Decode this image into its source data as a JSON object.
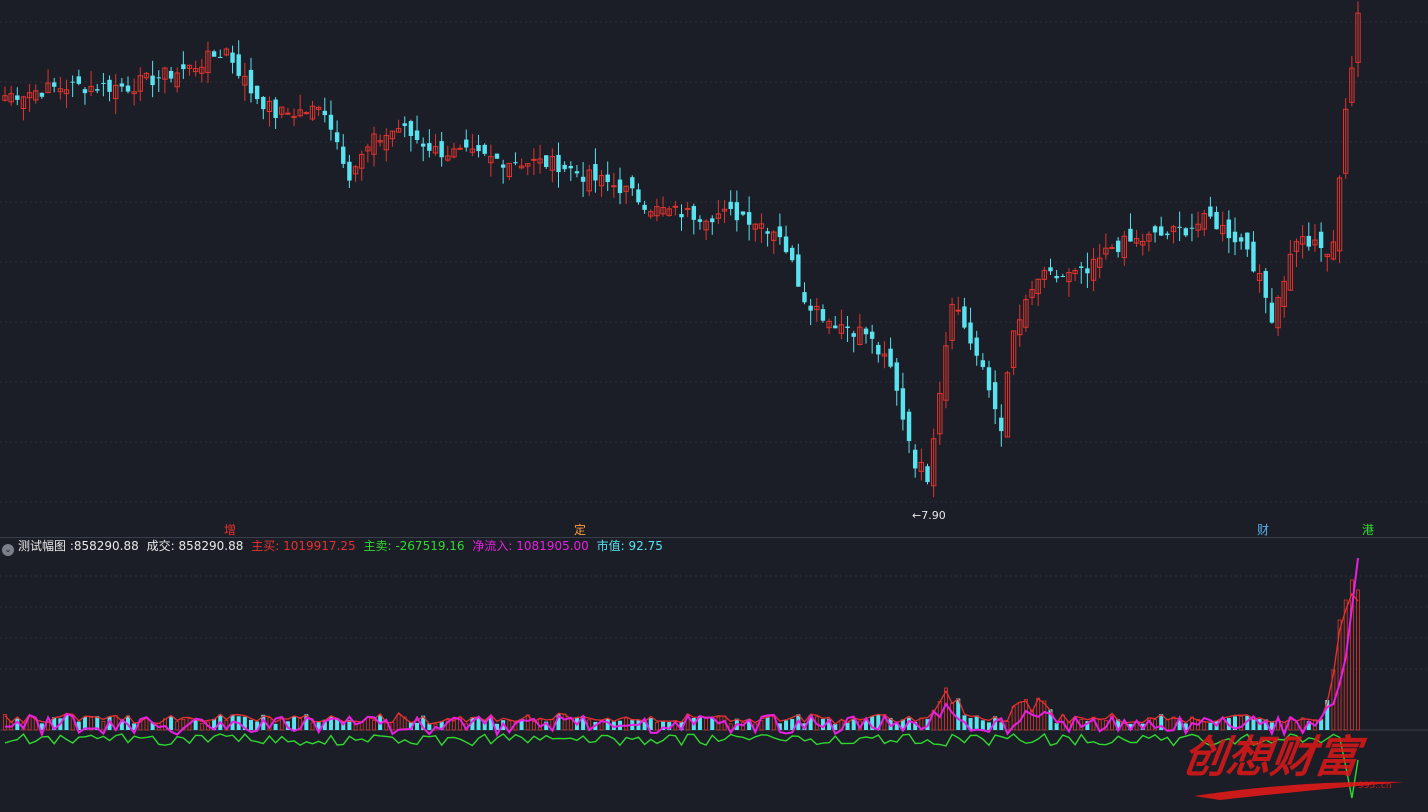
{
  "colors": {
    "background": "#1b1e26",
    "up": "#e0342e",
    "down": "#59e3f0",
    "grid": "#2c303a",
    "main_buy": "#e83030",
    "main_sell": "#30d830",
    "net_inflow": "#e820e0",
    "market_value": "#59e3f0",
    "watermark": "#e01818"
  },
  "chart_data": [
    {
      "type": "candlestick",
      "title": "",
      "price_low_label": "←7.90",
      "event_markers": [
        {
          "label": "增",
          "bar": 36,
          "color": "#e83030"
        },
        {
          "label": "定",
          "bar": 91,
          "color": "#ff9e3d"
        },
        {
          "label": "财",
          "bar": 197,
          "color": "#59aff0"
        },
        {
          "label": "港",
          "bar": 213,
          "color": "#36d836"
        }
      ],
      "ylim": [
        7.5,
        18.6
      ],
      "grid": true
    },
    {
      "type": "bar",
      "title": "",
      "indicator_name": "测试幅图",
      "indicator_value": "858290.88",
      "volume_label": "成交",
      "volume_value": "858290.88",
      "main_buy_label": "主买",
      "main_buy_value": "1019917.25",
      "main_sell_label": "主卖",
      "main_sell_value": "-267519.16",
      "net_inflow_label": "净流入",
      "net_inflow_value": "1081905.00",
      "market_value_label": "市值",
      "market_value_value": "92.75",
      "grid": true
    }
  ],
  "watermark": {
    "text": "创想财富",
    "site": "995..cn"
  }
}
